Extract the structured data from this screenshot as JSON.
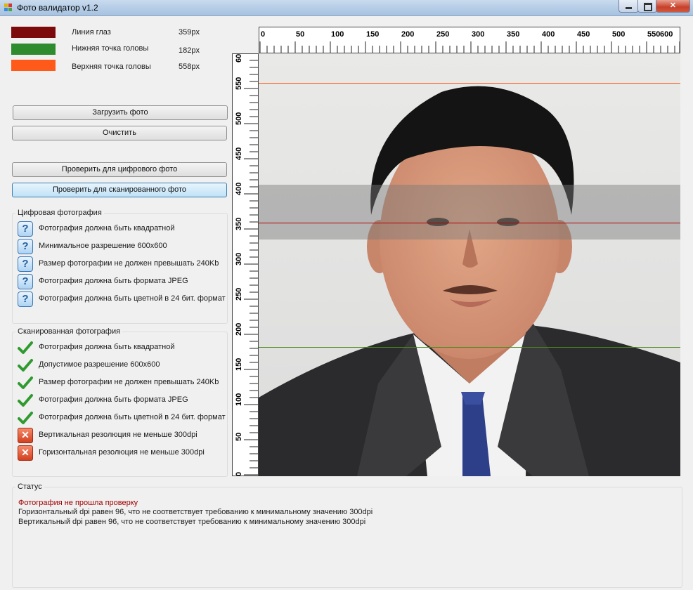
{
  "window": {
    "title": "Фото валидатор v1.2"
  },
  "legend": [
    {
      "label": "Линия глаз",
      "value": "359px",
      "color": "#7d0a0a"
    },
    {
      "label": "Нижняя точка головы",
      "value": "182px",
      "color": "#2e8b2e"
    },
    {
      "label": "Верхняя точка головы",
      "value": "558px",
      "color": "#ff5a1a"
    }
  ],
  "buttons": {
    "load": "Загрузить фото",
    "clear": "Очистить",
    "check_digital": "Проверить для цифрового фото",
    "check_scanned": "Проверить для сканированного фото"
  },
  "digital": {
    "title": "Цифровая фотография",
    "items": [
      {
        "text": "Фотография должна быть квадратной",
        "state": "unknown"
      },
      {
        "text": "Минимальное разрешение 600x600",
        "state": "unknown"
      },
      {
        "text": "Размер фотографии не должен превышать 240Kb",
        "state": "unknown"
      },
      {
        "text": "Фотография должна быть формата JPEG",
        "state": "unknown"
      },
      {
        "text": "Фотография должна быть цветной в 24 бит. формат",
        "state": "unknown"
      }
    ]
  },
  "scanned": {
    "title": "Сканированная фотография",
    "items": [
      {
        "text": "Фотография должна быть квадратной",
        "state": "pass"
      },
      {
        "text": "Допустимое разрешение 600x600",
        "state": "pass"
      },
      {
        "text": "Размер фотографии не должен превышать 240Kb",
        "state": "pass"
      },
      {
        "text": "Фотография должна быть формата JPEG",
        "state": "pass"
      },
      {
        "text": "Фотография должна быть цветной в 24 бит. формат",
        "state": "pass"
      },
      {
        "text": "Вертикальная резолюция не меньше 300dpi",
        "state": "fail"
      },
      {
        "text": "Горизонтальная резолюция не меньше 300dpi",
        "state": "fail"
      }
    ]
  },
  "ruler": {
    "top_labels": [
      "0",
      "50",
      "100",
      "150",
      "200",
      "250",
      "300",
      "350",
      "400",
      "450",
      "500",
      "550",
      "600"
    ],
    "left_labels": [
      "600",
      "550",
      "500",
      "450",
      "400",
      "350",
      "300",
      "250",
      "200",
      "150",
      "100",
      "50",
      "0"
    ]
  },
  "status": {
    "title": "Статус",
    "lines": [
      {
        "text": "Фотография не прошла проверку",
        "color": "#a00000"
      },
      {
        "text": "Горизонтальный dpi равен 96, что не соответствует требованию к минимальному значению 300dpi",
        "color": "#1a1a1a"
      },
      {
        "text": "Вертикальный dpi равен 96, что не соответствует требованию к минимальному значению 300dpi",
        "color": "#1a1a1a"
      }
    ]
  }
}
